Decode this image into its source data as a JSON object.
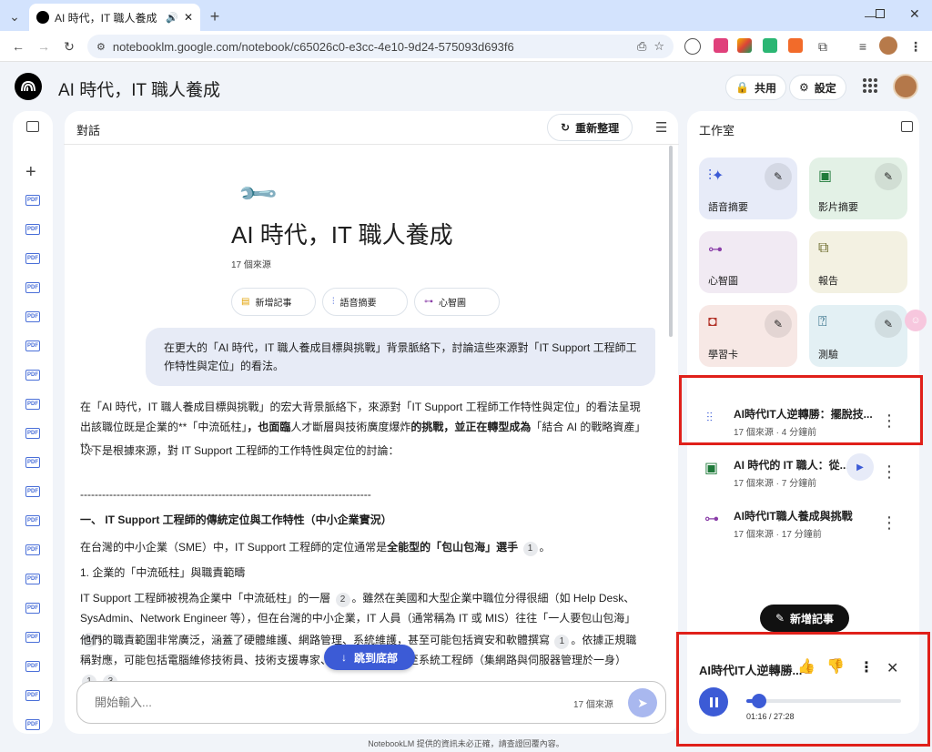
{
  "browser": {
    "tab_title": "AI 時代，IT 職人養成 - Note",
    "url": "notebooklm.google.com/notebook/c65026c0-e3cc-4e10-9d24-575093d693f6",
    "new_tab": "+"
  },
  "header": {
    "title": "AI 時代，IT 職人養成",
    "share_label": "共用",
    "settings_label": "設定"
  },
  "chat": {
    "panel_title": "對話",
    "refresh_label": "重新整理",
    "nb_title": "AI 時代，IT 職人養成",
    "source_count": "17 個來源",
    "actions": [
      "新增記事",
      "語音摘要",
      "心智圖"
    ],
    "user_question": "在更大的「AI 時代，IT 職人養成目標與挑戰」背景脈絡下，討論這些來源對「IT Support 工程師工作特性與定位」的看法。",
    "answer_p1_a": "在「AI 時代，IT 職人養成目標與挑戰」的宏大背景脈絡下，來源對「IT Support 工程師工作特性與定位」的看法呈現出該職位既是企業的**「中流砥柱」",
    "answer_p1_b": "，也面臨",
    "answer_p1_c": "人才斷層與技術廣度爆炸",
    "answer_p1_d": "的挑戰，並正在轉型成為",
    "answer_p1_e": "「結合 AI 的戰略資產」**。",
    "answer_p2": "以下是根據來源，對 IT Support 工程師的工作特性與定位的討論：",
    "divider": "--------------------------------------------------------------------------------",
    "section1": "一、 IT Support 工程師的傳統定位與工作特性（中小企業實況）",
    "p3_a": "在台灣的中小企業（SME）中，IT Support 工程師的定位通常是",
    "p3_b": "全能型的「包山包海」選手",
    "cite1": "1",
    "sub1": "1. 企業的「中流砥柱」與職責範疇",
    "p4": "IT Support 工程師被視為企業中「中流砥柱」的一層",
    "cite2": "2",
    "p4b": "。雖然在美國和大型企業中職位分得很細（如 Help Desk、SysAdmin、Network Engineer 等），但在台灣的中小企業，IT 人員（通常稱為 IT 或 MIS）往往「一人要包山包海」",
    "p5": "他們的職責範圍非常廣泛，涵蓋了硬體維護、網路管理、系統維護，甚至可能包括資安和軟體撰寫",
    "p5b": "。依據正規職稱對應，可能包括電腦維修技術員、技術支援專家、服務中心",
    "p5c": "員，甚至系統工程師（集網路與伺服器管理於一身）",
    "cite3": "3",
    "jump_label": "跳到底部",
    "input_placeholder": "開始輸入...",
    "input_sources": "17 個來源",
    "footer": "NotebookLM 提供的資訊未必正確，請查證回覆內容。"
  },
  "studio": {
    "panel_title": "工作室",
    "cards": [
      {
        "label": "語音摘要",
        "icon": "audio-wave-icon",
        "bg": "#e7ebf8"
      },
      {
        "label": "影片摘要",
        "icon": "video-icon",
        "bg": "#e3f1e6"
      },
      {
        "label": "心智圖",
        "icon": "mindmap-icon",
        "bg": "#f1eaf3"
      },
      {
        "label": "報告",
        "icon": "report-icon",
        "bg": "#f3f1e2"
      },
      {
        "label": "學習卡",
        "icon": "flashcard-icon",
        "bg": "#f7e8e5"
      },
      {
        "label": "測驗",
        "icon": "quiz-icon",
        "bg": "#e3f0f4"
      }
    ],
    "notes": [
      {
        "title": "AI時代IT人逆轉勝：擺脫技...",
        "meta": "17 個來源 · 4 分鐘前"
      },
      {
        "title": "AI 時代的 IT 職人：從...",
        "meta": "17 個來源 · 7 分鐘前"
      },
      {
        "title": "AI時代IT職人養成與挑戰",
        "meta": "17 個來源 · 17 分鐘前"
      }
    ],
    "add_note_label": "新增記事"
  },
  "player": {
    "title": "AI時代IT人逆轉勝...",
    "time": "01:16 / 27:28",
    "progress": 0.046
  },
  "colors": {
    "accent": "#3c5bd6",
    "red_highlight": "#e0201a"
  }
}
